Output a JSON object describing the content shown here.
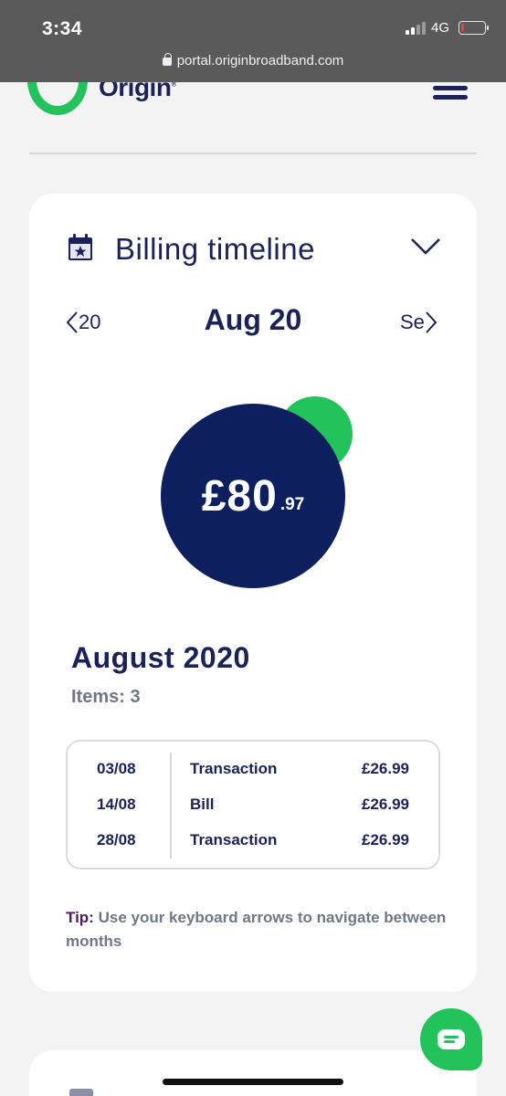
{
  "status": {
    "time": "3:34",
    "network": "4G"
  },
  "browser": {
    "url": "portal.originbroadband.com"
  },
  "header": {
    "logo_text": "Origin"
  },
  "billing": {
    "title": "Billing timeline",
    "prev_month": "20",
    "current_month": "Aug 20",
    "next_month": "Se",
    "amount_main": "£80",
    "amount_pence": ".97",
    "month_heading": "August 2020",
    "items_count": "Items: 3",
    "transactions": [
      {
        "date": "03/08",
        "type": "Transaction",
        "amount": "£26.99"
      },
      {
        "date": "14/08",
        "type": "Bill",
        "amount": "£26.99"
      },
      {
        "date": "28/08",
        "type": "Transaction",
        "amount": "£26.99"
      }
    ],
    "tip_label": "Tip:",
    "tip_text": " Use your keyboard arrows to navigate between months"
  },
  "colors": {
    "brand_green": "#21c35a",
    "navy": "#1a2259",
    "circle_navy": "#0d1f5e"
  },
  "icons": [
    "lock-icon",
    "calendar-star-icon",
    "chevron-down-icon",
    "chevron-left-icon",
    "chevron-right-icon",
    "menu-icon",
    "chat-icon"
  ]
}
